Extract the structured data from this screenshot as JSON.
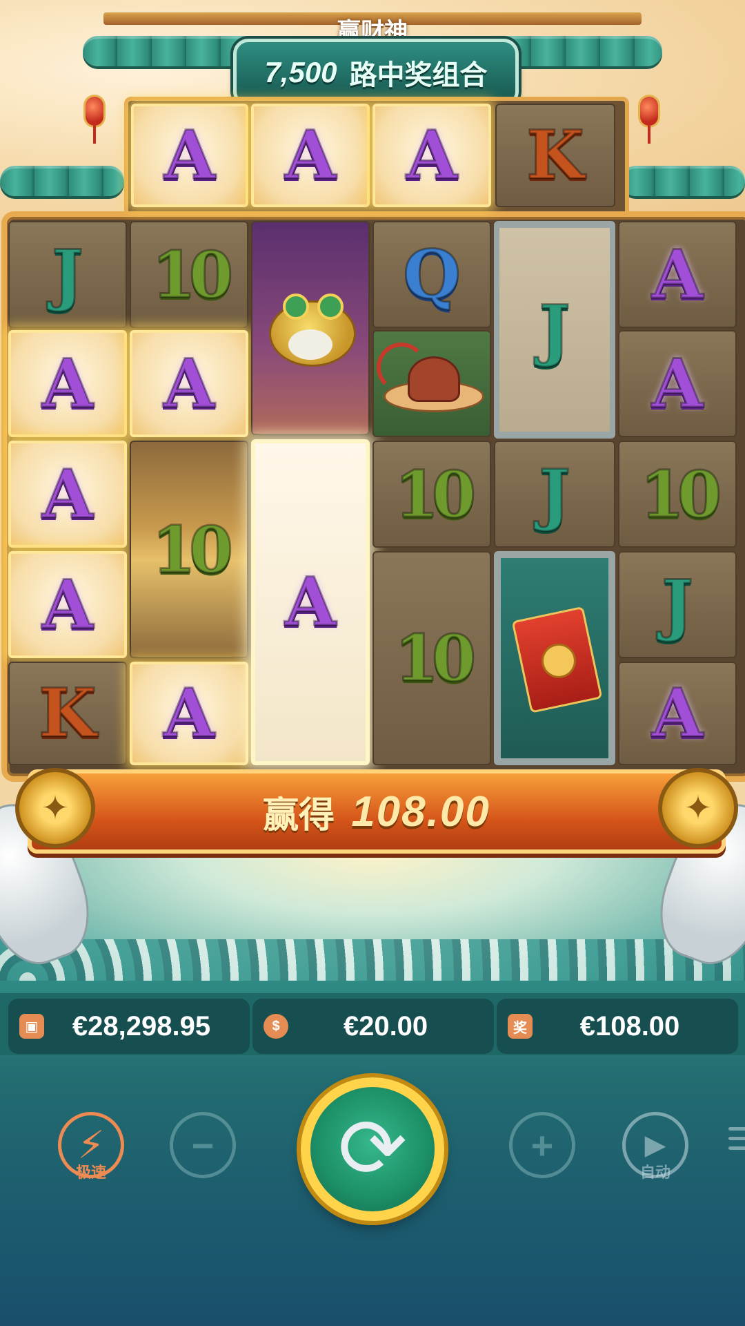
{
  "header": {
    "game_title": "赢财神",
    "ways_number": "7,500",
    "ways_text": "路中奖组合"
  },
  "reels": {
    "top_row": [
      {
        "symbol": "A",
        "highlighted": true
      },
      {
        "symbol": "A",
        "highlighted": true
      },
      {
        "symbol": "A",
        "highlighted": true
      },
      {
        "symbol": "K",
        "highlighted": false
      }
    ],
    "col1": [
      "J",
      "A",
      "A",
      "A",
      "K"
    ],
    "col2": [
      "10",
      "A",
      "10",
      "A"
    ],
    "col3": [
      "toad",
      "A"
    ],
    "col4": [
      "Q",
      "hat",
      "10",
      "10"
    ],
    "col5": [
      "J",
      "J",
      "red-envelope"
    ],
    "col6": [
      "A",
      "A",
      "10",
      "J",
      "A"
    ]
  },
  "win_bar": {
    "label": "赢得",
    "amount": "108.00"
  },
  "stats": {
    "balance": "€28,298.95",
    "bet": "€20.00",
    "win": "€108.00",
    "win_icon_text": "奖"
  },
  "controls": {
    "turbo_label": "极速",
    "auto_label": "自动",
    "minus": "−",
    "plus": "+",
    "spin_icon": "spin-icon"
  },
  "colors": {
    "accent_gold": "#ffd34a",
    "spin_green": "#1c8f66",
    "win_orange": "#d6561a",
    "symbol_A": "#a24fd8",
    "symbol_J": "#2a9c7c",
    "symbol_10": "#6f9a2e",
    "symbol_K": "#c5531e",
    "symbol_Q": "#3a7fd0"
  }
}
